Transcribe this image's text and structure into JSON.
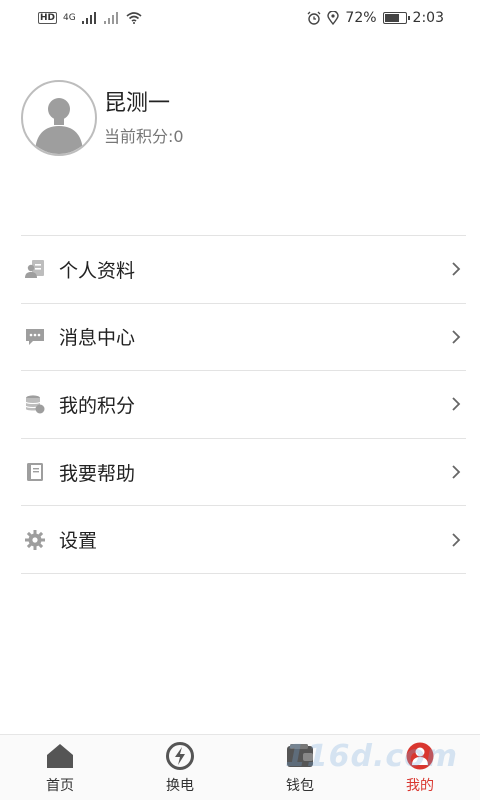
{
  "status_bar": {
    "hd": "HD",
    "network": "4G",
    "battery_percent": "72%",
    "battery_level": 0.72,
    "time": "2:03"
  },
  "profile": {
    "name": "昆测一",
    "points": "当前积分:0"
  },
  "menu": {
    "items": [
      {
        "label": "个人资料",
        "icon": "profile-card-icon"
      },
      {
        "label": "消息中心",
        "icon": "message-icon"
      },
      {
        "label": "我的积分",
        "icon": "coins-icon"
      },
      {
        "label": "我要帮助",
        "icon": "book-icon"
      },
      {
        "label": "设置",
        "icon": "gear-icon"
      }
    ]
  },
  "bottom_nav": {
    "items": [
      {
        "label": "首页",
        "icon": "home-icon"
      },
      {
        "label": "换电",
        "icon": "battery-swap-icon"
      },
      {
        "label": "钱包",
        "icon": "wallet-icon"
      },
      {
        "label": "我的",
        "icon": "user-icon",
        "active": true
      }
    ]
  },
  "watermark": "116d.com",
  "colors": {
    "accent": "#d9362f",
    "icon_gray": "#9e9e9e",
    "divider": "#e3e3e3"
  }
}
